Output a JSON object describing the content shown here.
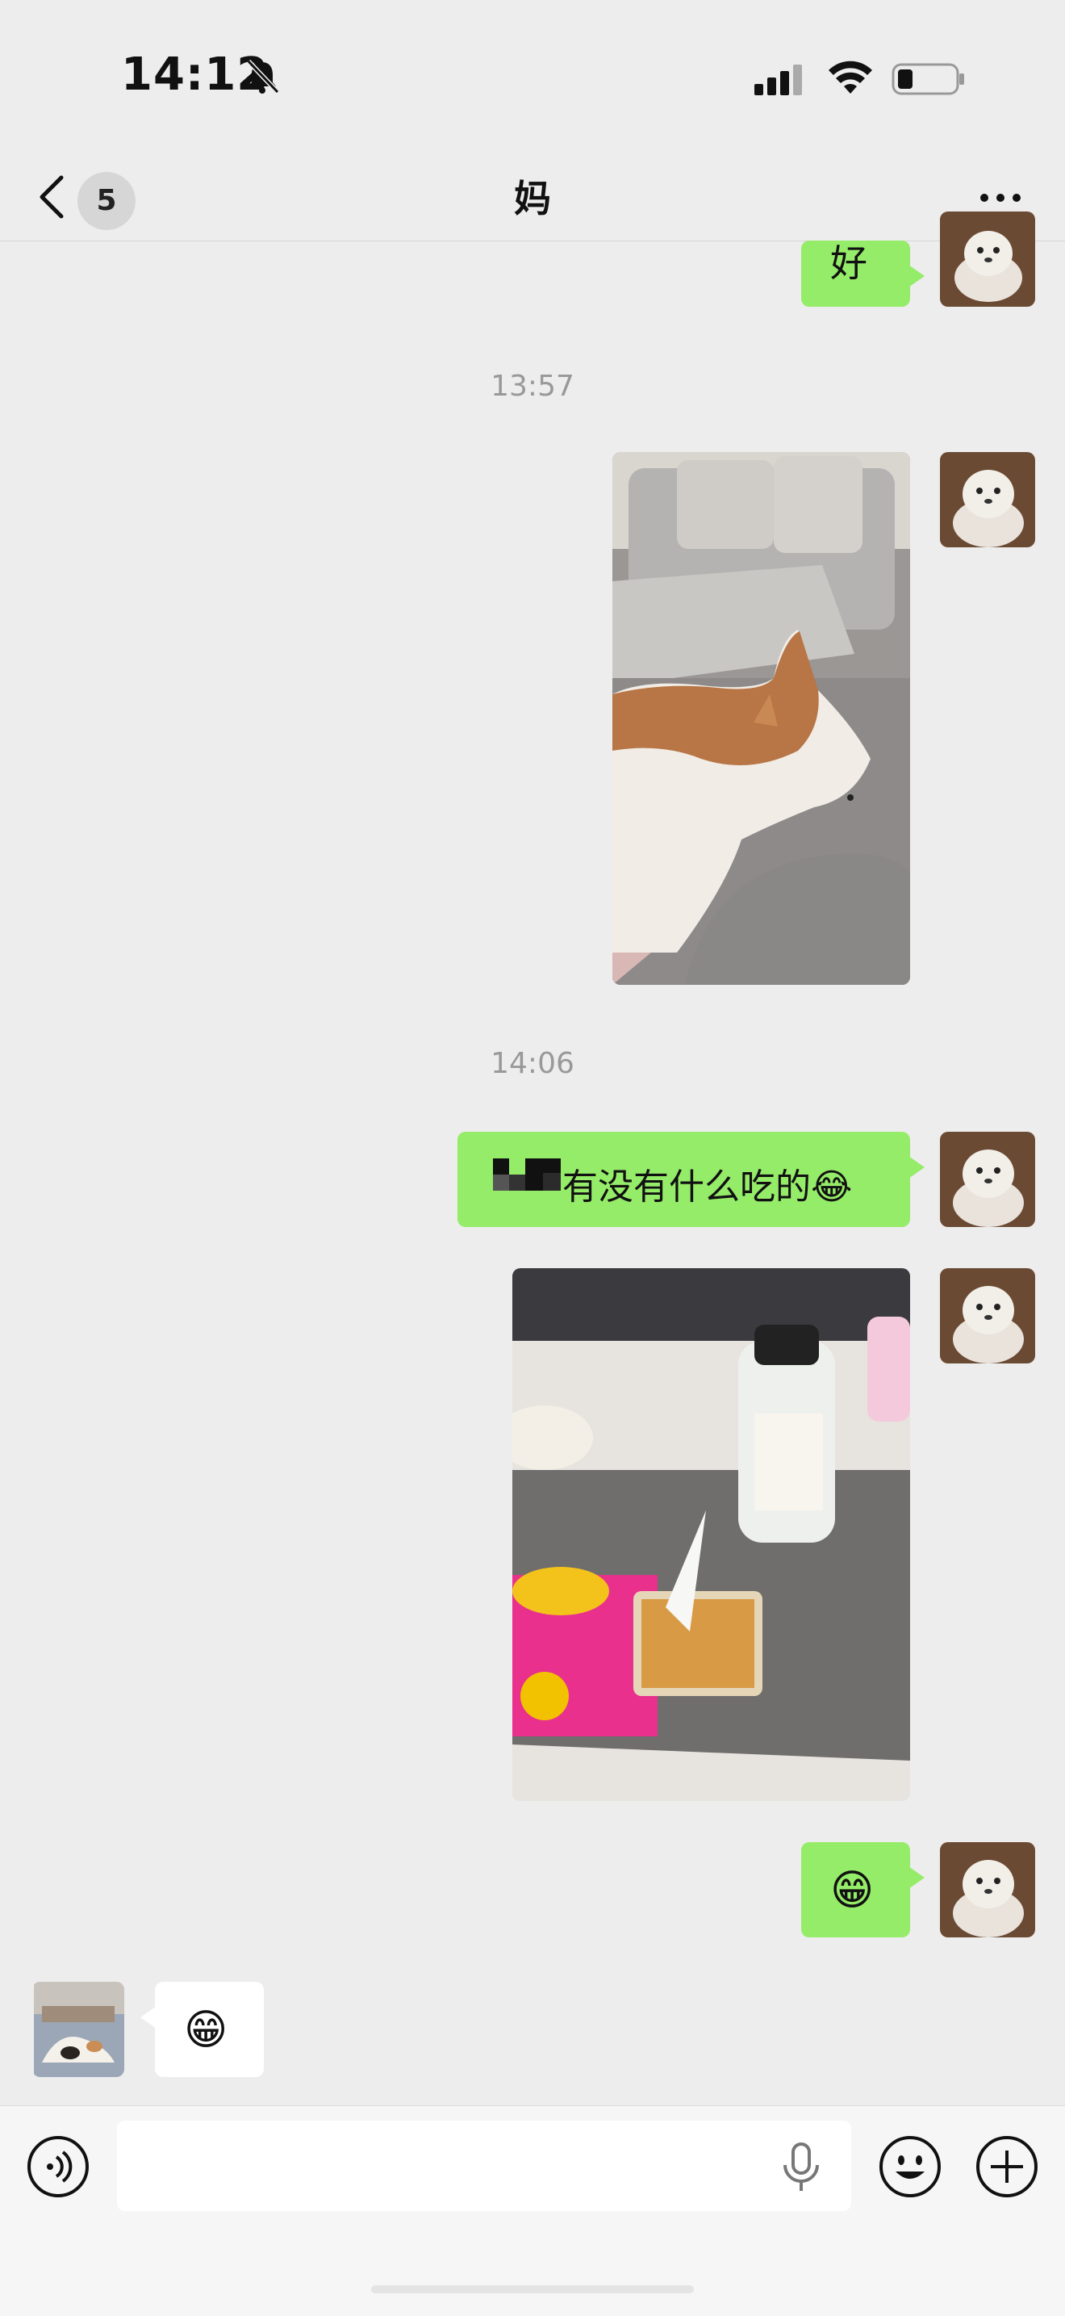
{
  "status_bar": {
    "time": "14:12",
    "icons": [
      "bell-muted-icon",
      "cellular-signal-icon",
      "wifi-icon",
      "battery-icon"
    ]
  },
  "header": {
    "unread_count": "5",
    "title": "妈",
    "back_icon": "chevron-left-icon",
    "more_icon": "more-dots-icon"
  },
  "messages": {
    "m1": {
      "text": "好"
    },
    "ts1": "13:57",
    "ts2": "14:06",
    "m3": {
      "text": "有没有什么吃的😂"
    },
    "m5": {
      "text": "😁"
    },
    "m6": {
      "text": "😁"
    }
  },
  "input_bar": {
    "placeholder": "",
    "icons": [
      "voice-icon",
      "mic-icon",
      "emoji-icon",
      "plus-icon"
    ]
  },
  "colors": {
    "self_bubble": "#95ec69",
    "other_bubble": "#ffffff",
    "background": "#ededed"
  }
}
